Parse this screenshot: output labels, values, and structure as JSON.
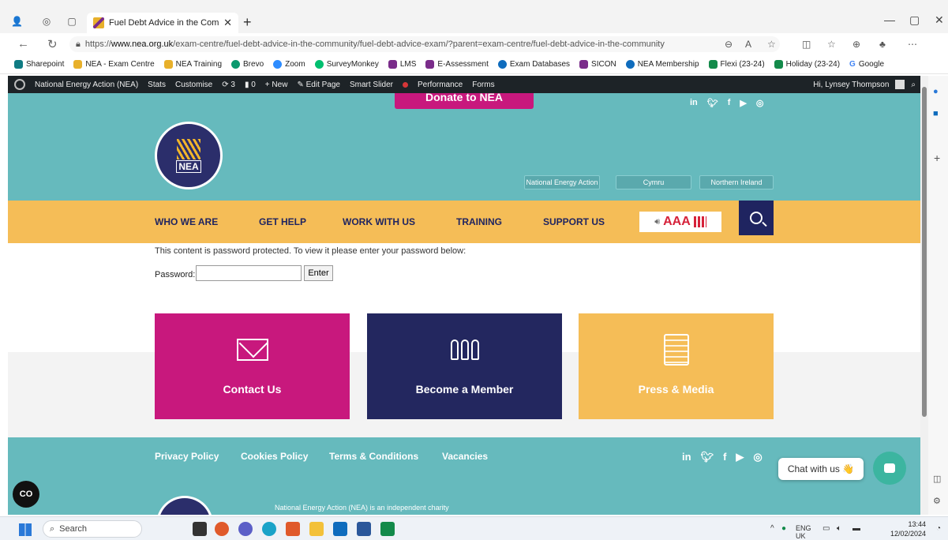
{
  "browser": {
    "tab_title": "Fuel Debt Advice in the Commun",
    "url_prefix": "https://",
    "url_host": "www.nea.org.uk",
    "url_path": "/exam-centre/fuel-debt-advice-in-the-community/fuel-debt-advice-exam/?parent=exam-centre/fuel-debt-advice-in-the-community",
    "bookmarks": [
      "Sharepoint",
      "NEA - Exam Centre",
      "NEA Training",
      "Brevo",
      "Zoom",
      "SurveyMonkey",
      "LMS",
      "E-Assessment",
      "Exam Databases",
      "SICON",
      "NEA Membership",
      "Flexi (23-24)",
      "Holiday (23-24)",
      "Google"
    ]
  },
  "adminbar": {
    "site": "National Energy Action (NEA)",
    "stats": "Stats",
    "customise": "Customise",
    "updates": "3",
    "comments": "0",
    "new": "New",
    "edit": "Edit Page",
    "slider": "Smart Slider",
    "performance": "Performance",
    "forms": "Forms",
    "greeting": "Hi, Lynsey Thompson"
  },
  "header": {
    "donate": "Donate to NEA",
    "logo_text": "NEA",
    "lang_links": [
      "National Energy Action",
      "Cymru",
      "Northern Ireland"
    ]
  },
  "nav": {
    "items": [
      "WHO WE ARE",
      "GET HELP",
      "WORK WITH US",
      "TRAINING",
      "SUPPORT US"
    ],
    "access_text": "AAA"
  },
  "password": {
    "message": "This content is password protected. To view it please enter your password below:",
    "label": "Password:",
    "value": "",
    "button": "Enter"
  },
  "cards": [
    {
      "label": "Contact Us",
      "color": "#c8187d"
    },
    {
      "label": "Become a Member",
      "color": "#23275f"
    },
    {
      "label": "Press & Media",
      "color": "#f5bd57"
    }
  ],
  "footer": {
    "links": [
      "Privacy Policy",
      "Cookies Policy",
      "Terms & Conditions",
      "Vacancies"
    ],
    "charity_text": "National Energy Action (NEA) is an independent charity"
  },
  "chat": {
    "label": "Chat with us 👋"
  },
  "taskbar": {
    "search": "Search",
    "lang": "ENG",
    "region": "UK",
    "time": "13:44",
    "date": "12/02/2024"
  }
}
